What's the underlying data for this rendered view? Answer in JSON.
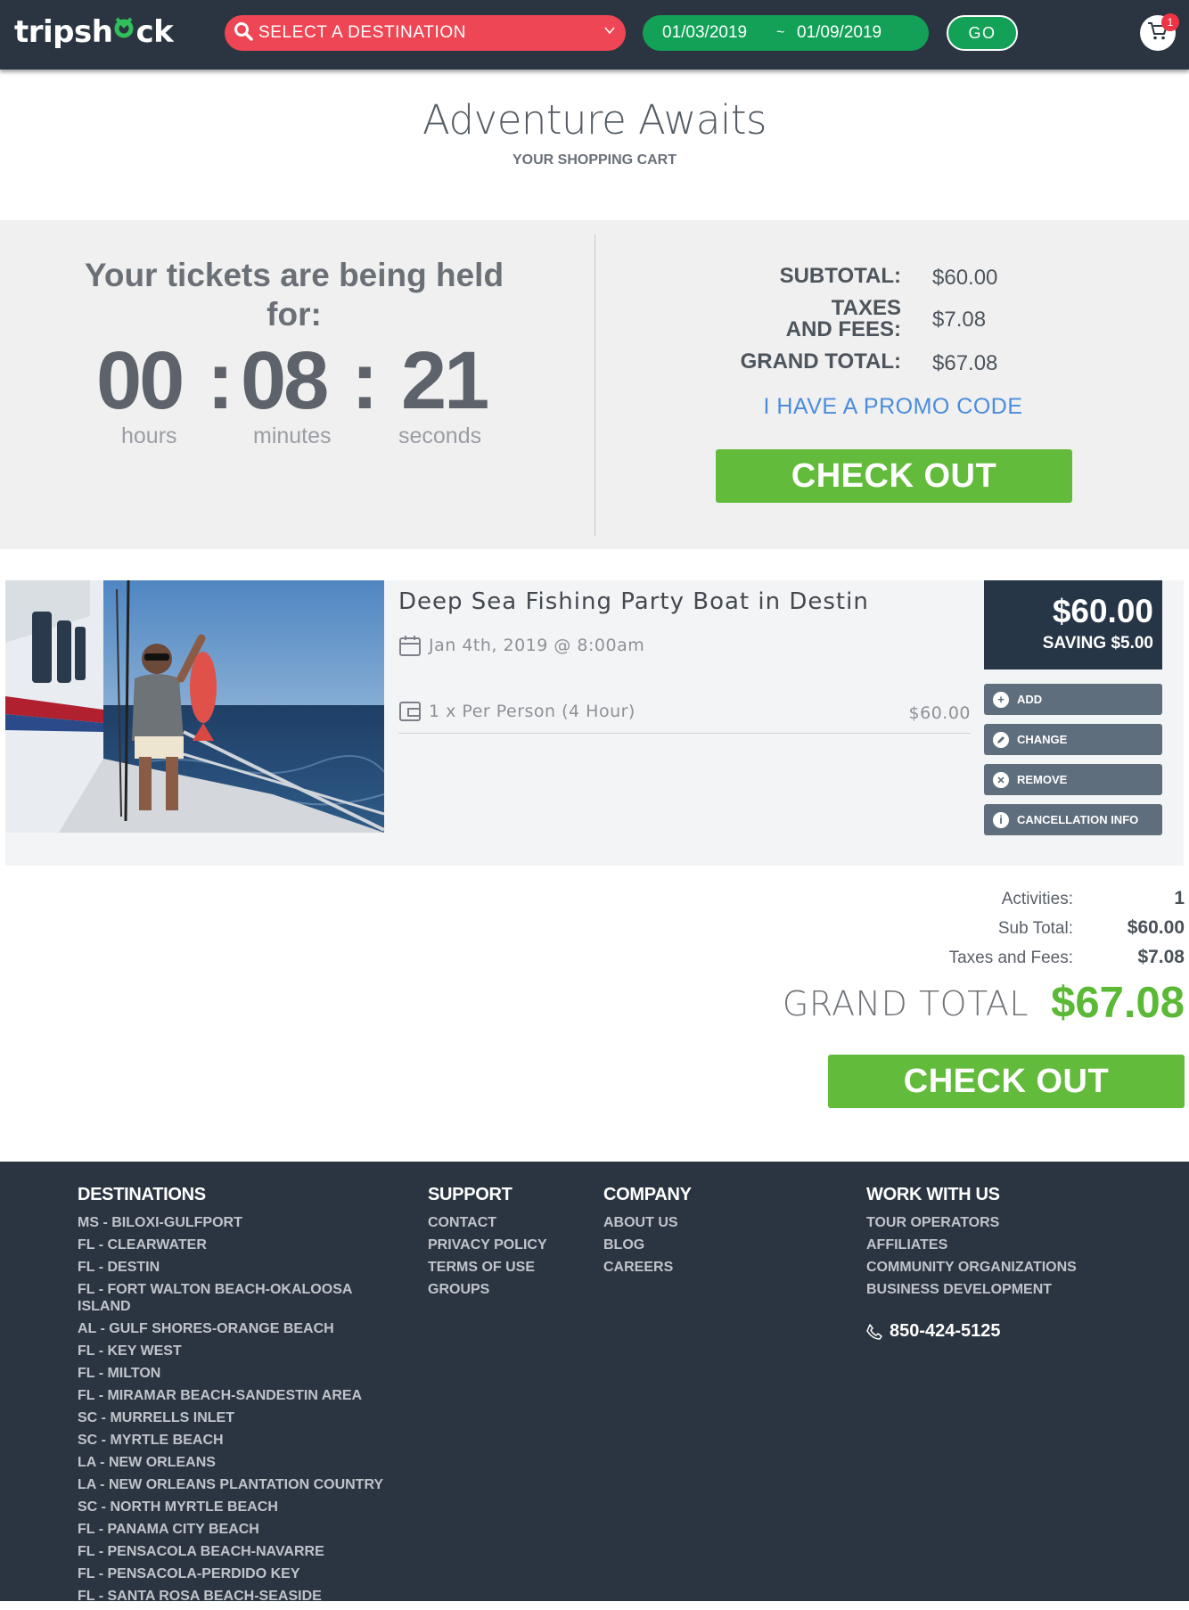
{
  "header": {
    "logo_left": "tripsh",
    "logo_mid": "o",
    "logo_right": "ck",
    "destination_placeholder": "SELECT A DESTINATION",
    "date_start": "01/03/2019",
    "date_sep": "~",
    "date_end": "01/09/2019",
    "go_label": "GO",
    "cart_count": "1",
    "colors": {
      "bar": "#2b3541",
      "destination": "#ee4654",
      "dates": "#12a157"
    }
  },
  "page": {
    "title": "Adventure Awaits",
    "subtitle": "YOUR SHOPPING CART"
  },
  "hold": {
    "message": "Your tickets are being held for:",
    "hours": "00",
    "minutes": "08",
    "seconds": "21",
    "sep1": ":",
    "sep2": ":",
    "hours_label": "hours",
    "minutes_label": "minutes",
    "seconds_label": "seconds"
  },
  "summary": {
    "subtotal_label": "SUBTOTAL:",
    "subtotal_value": "$60.00",
    "taxes_label_1": "TAXES",
    "taxes_label_2": "AND FEES:",
    "taxes_value": "$7.08",
    "grand_label": "GRAND TOTAL:",
    "grand_value": "$67.08",
    "promo_label": "I HAVE A PROMO CODE",
    "checkout_label": "CHECK OUT"
  },
  "item": {
    "title": "Deep Sea Fishing Party Boat in Destin",
    "date": "Jan 4th, 2019 @ 8:00am",
    "line_desc": "1 x Per Person (4 Hour)",
    "line_price": "$60.00",
    "price": "$60.00",
    "saving": "SAVING $5.00",
    "actions": [
      {
        "label": "ADD",
        "icon": "plus-icon"
      },
      {
        "label": "CHANGE",
        "icon": "edit-icon"
      },
      {
        "label": "REMOVE",
        "icon": "close-icon"
      },
      {
        "label": "CANCELLATION INFO",
        "icon": "info-icon"
      }
    ]
  },
  "totals": {
    "activities_label": "Activities:",
    "activities_value": "1",
    "subtotal_label": "Sub Total:",
    "subtotal_value": "$60.00",
    "taxes_label": "Taxes and Fees:",
    "taxes_value": "$7.08",
    "grand_label": "GRAND TOTAL",
    "grand_value": "$67.08",
    "checkout_label": "CHECK OUT",
    "colors": {
      "grand": "#5bb936",
      "checkout": "#62bb3b"
    }
  },
  "footer": {
    "destinations_head": "DESTINATIONS",
    "destinations": [
      "MS - BILOXI-GULFPORT",
      "FL - CLEARWATER",
      "FL - DESTIN",
      "FL - FORT WALTON BEACH-OKALOOSA ISLAND",
      "AL - GULF SHORES-ORANGE BEACH",
      "FL - KEY WEST",
      "FL - MILTON",
      "FL - MIRAMAR BEACH-SANDESTIN AREA",
      "SC - MURRELLS INLET",
      "SC - MYRTLE BEACH",
      "LA - NEW ORLEANS",
      "LA - NEW ORLEANS PLANTATION COUNTRY",
      "SC - NORTH MYRTLE BEACH",
      "FL - PANAMA CITY BEACH",
      "FL - PENSACOLA BEACH-NAVARRE",
      "FL - PENSACOLA-PERDIDO KEY",
      "FL - SANTA ROSA BEACH-SEASIDE"
    ],
    "support_head": "SUPPORT",
    "support": [
      "CONTACT",
      "PRIVACY POLICY",
      "TERMS OF USE",
      "GROUPS"
    ],
    "company_head": "COMPANY",
    "company": [
      "ABOUT US",
      "BLOG",
      "CAREERS"
    ],
    "work_head": "WORK WITH US",
    "work": [
      "TOUR OPERATORS",
      "AFFILIATES",
      "COMMUNITY ORGANIZATIONS",
      "BUSINESS DEVELOPMENT"
    ],
    "phone": "850-424-5125"
  }
}
